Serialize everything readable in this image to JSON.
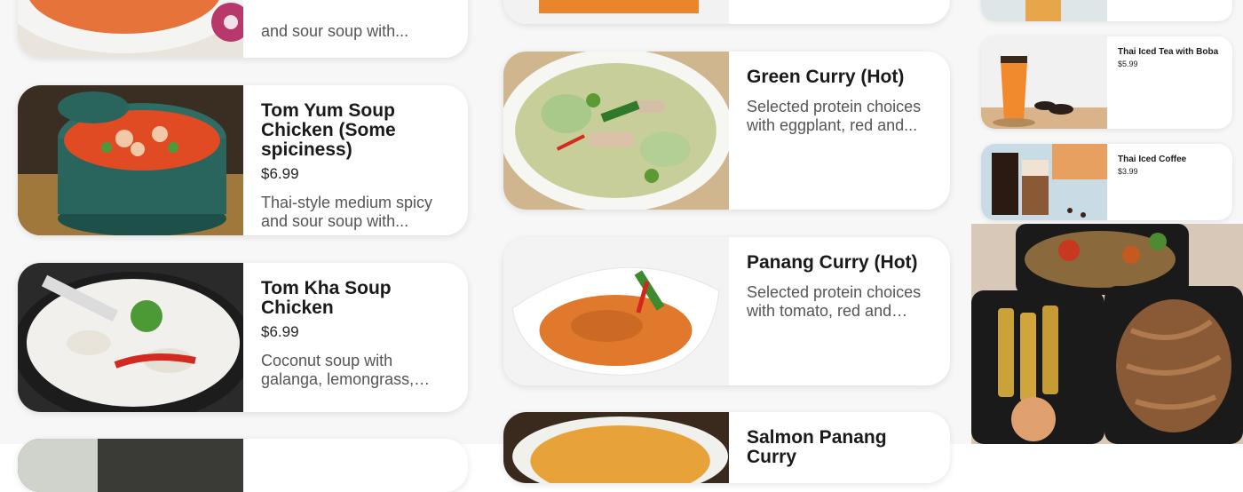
{
  "left_column": {
    "items": [
      {
        "title": "",
        "price": "",
        "description": "and sour soup with..."
      },
      {
        "title": "Tom Yum Soup Chicken (Some spiciness)",
        "price": "$6.99",
        "description": "Thai-style medium spicy and sour soup with..."
      },
      {
        "title": "Tom Kha Soup Chicken",
        "price": "$6.99",
        "description": "Coconut soup with galanga, lemongrass, lime..."
      }
    ]
  },
  "middle_column": {
    "items": [
      {
        "title": "Green Curry (Hot)",
        "description": "Selected protein choices with eggplant, red and..."
      },
      {
        "title": "Panang Curry (Hot)",
        "description": "Selected protein choices with tomato, red and gree..."
      },
      {
        "title": "Salmon Panang Curry"
      }
    ]
  },
  "right_column": {
    "items": [
      {
        "title": "Thai Iced Tea with Boba",
        "price": "$5.99"
      },
      {
        "title": "Thai Iced Coffee",
        "price": "$3.99"
      }
    ]
  },
  "colors": {
    "card_bg": "#ffffff",
    "page_bg": "#f7f7f7",
    "text": "#1a1a1a",
    "muted": "#555555"
  }
}
